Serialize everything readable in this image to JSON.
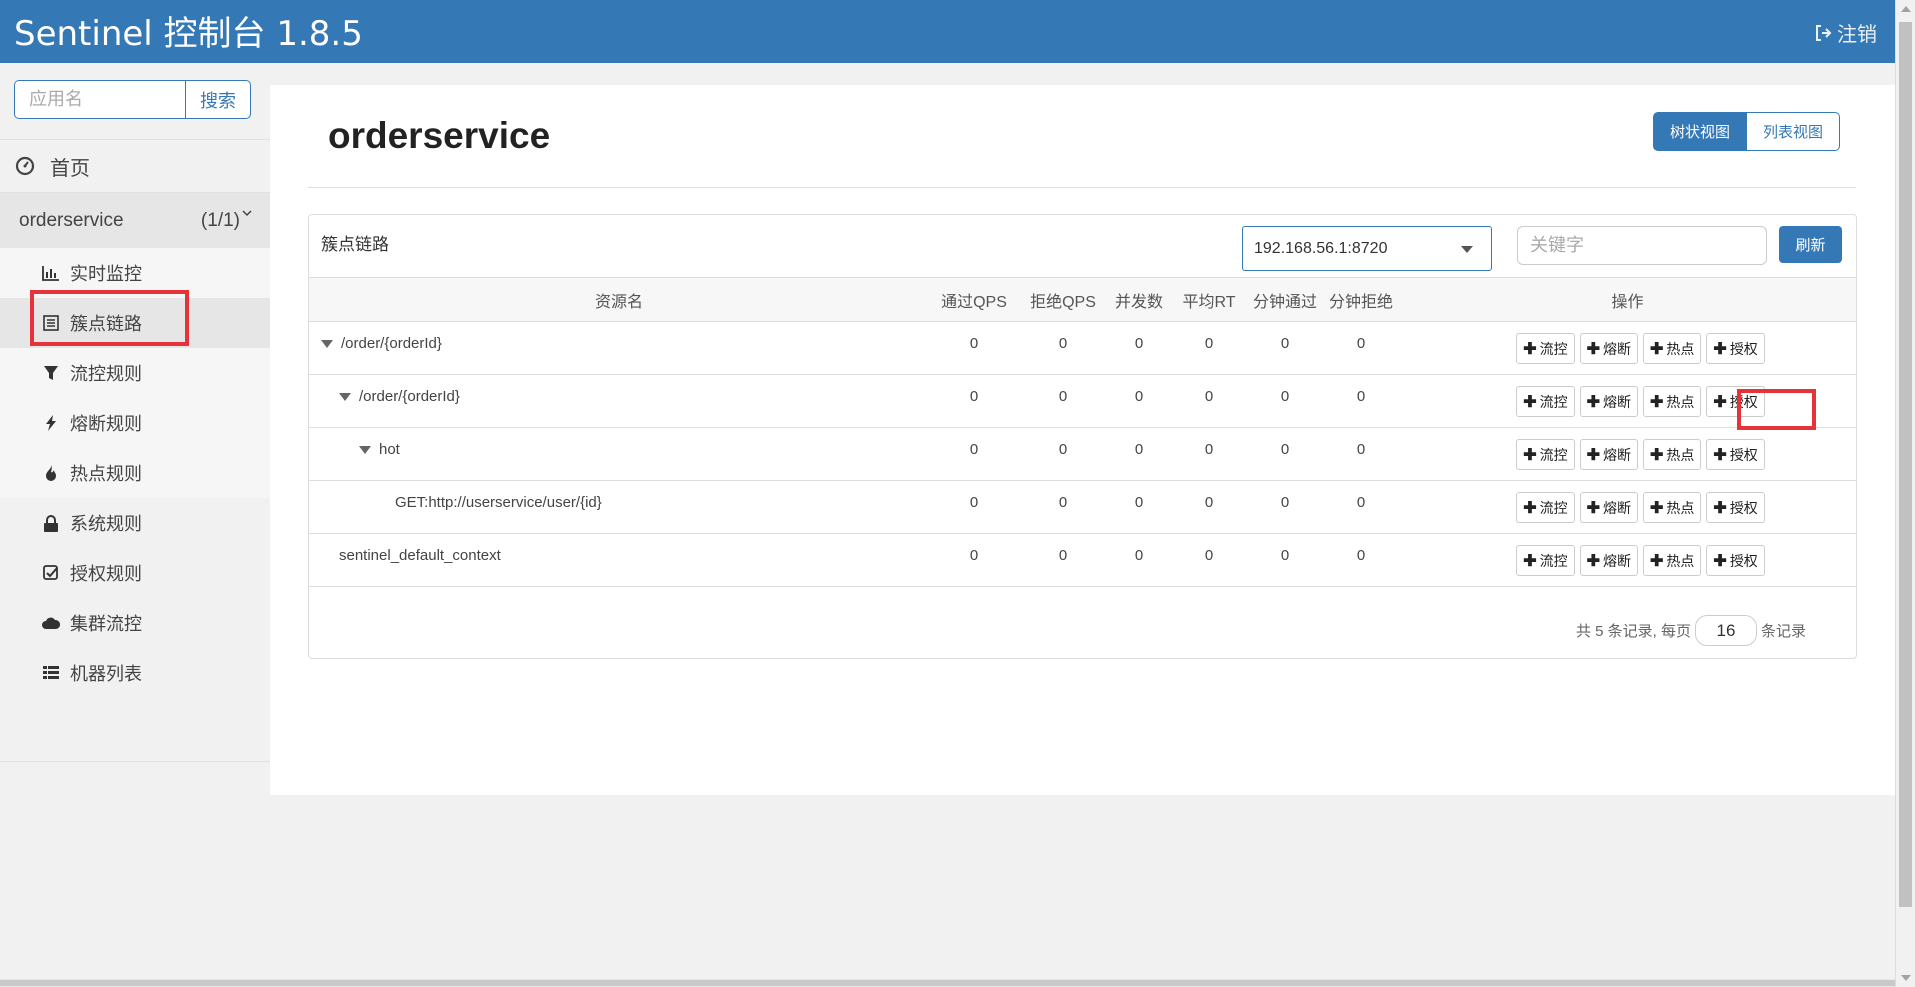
{
  "header": {
    "brand": "Sentinel 控制台 1.8.5",
    "logout": "注销"
  },
  "sidebar": {
    "search_placeholder": "应用名",
    "search_button": "搜索",
    "home": "首页",
    "app": {
      "name": "orderservice",
      "count": "(1/1)"
    },
    "items": [
      {
        "label": "实时监控",
        "icon": "bar-chart-icon"
      },
      {
        "label": "簇点链路",
        "icon": "list-icon"
      },
      {
        "label": "流控规则",
        "icon": "filter-icon"
      },
      {
        "label": "熔断规则",
        "icon": "bolt-icon"
      },
      {
        "label": "热点规则",
        "icon": "fire-icon"
      },
      {
        "label": "系统规则",
        "icon": "lock-icon"
      },
      {
        "label": "授权规则",
        "icon": "check-icon"
      },
      {
        "label": "集群流控",
        "icon": "cloud-icon"
      },
      {
        "label": "机器列表",
        "icon": "table-icon"
      }
    ]
  },
  "main": {
    "title": "orderservice",
    "view_tree": "树状视图",
    "view_list": "列表视图",
    "panel_title": "簇点链路",
    "machine": "192.168.56.1:8720",
    "keyword_placeholder": "关键字",
    "refresh": "刷新",
    "columns": [
      "资源名",
      "通过QPS",
      "拒绝QPS",
      "并发数",
      "平均RT",
      "分钟通过",
      "分钟拒绝",
      "操作"
    ],
    "rows": [
      {
        "name": "/order/{orderId}",
        "pass": "0",
        "block": "0",
        "thread": "0",
        "rt": "0",
        "min_pass": "0",
        "min_block": "0"
      },
      {
        "name": "/order/{orderId}",
        "pass": "0",
        "block": "0",
        "thread": "0",
        "rt": "0",
        "min_pass": "0",
        "min_block": "0"
      },
      {
        "name": "hot",
        "pass": "0",
        "block": "0",
        "thread": "0",
        "rt": "0",
        "min_pass": "0",
        "min_block": "0"
      },
      {
        "name": "GET:http://userservice/user/{id}",
        "pass": "0",
        "block": "0",
        "thread": "0",
        "rt": "0",
        "min_pass": "0",
        "min_block": "0"
      },
      {
        "name": "sentinel_default_context",
        "pass": "0",
        "block": "0",
        "thread": "0",
        "rt": "0",
        "min_pass": "0",
        "min_block": "0"
      }
    ],
    "ops": {
      "flow": "流控",
      "degrade": "熔断",
      "hot": "热点",
      "auth": "授权"
    },
    "pager": {
      "prefix": "共 5 条记录, 每页",
      "page_size": "16",
      "suffix": "条记录"
    }
  },
  "colors": {
    "header": "#3578b6",
    "highlight": "#e5323b"
  }
}
